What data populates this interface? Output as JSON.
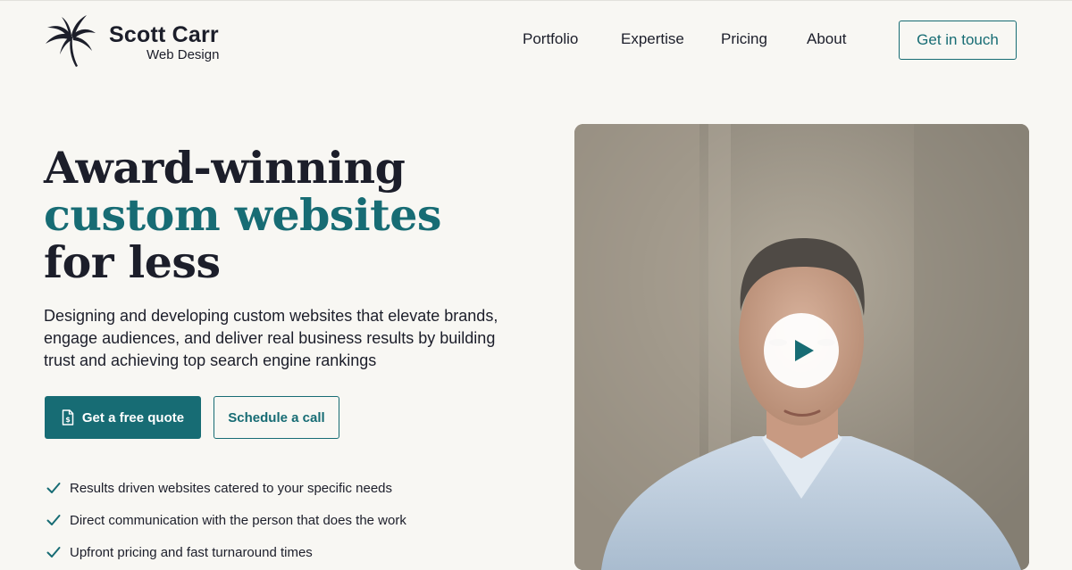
{
  "brand": {
    "name": "Scott Carr",
    "tagline": "Web Design"
  },
  "nav": {
    "items": [
      "Portfolio",
      "Expertise",
      "Pricing",
      "About"
    ],
    "cta": "Get in touch"
  },
  "hero": {
    "title_line1": "Award-winning",
    "title_line2": "custom websites",
    "title_line3": "for less",
    "description": "Designing and developing custom websites that elevate brands, engage audiences, and deliver real business results by building trust and achieving top search engine rankings",
    "primary_button": "Get a free quote",
    "secondary_button": "Schedule a call",
    "features": [
      "Results driven websites catered to your specific needs",
      "Direct communication with the person that does the work",
      "Upfront pricing and fast turnaround times"
    ]
  },
  "video": {
    "icon": "play-icon"
  },
  "colors": {
    "accent": "#176c74",
    "text": "#1c1e2a",
    "background": "#f8f7f3"
  }
}
